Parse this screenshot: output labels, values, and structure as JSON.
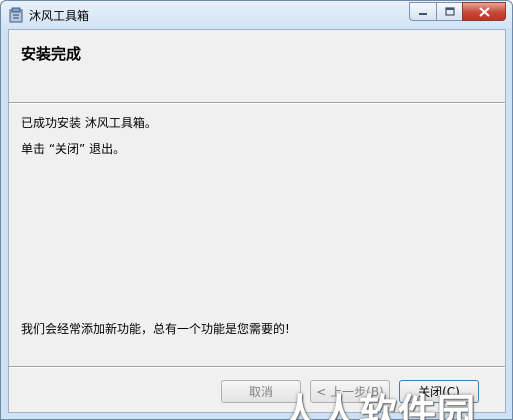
{
  "window": {
    "title": "沐风工具箱",
    "app_icon": "installer-box-icon",
    "controls": {
      "minimize": "minimize-icon",
      "maximize": "maximize-icon",
      "close": "close-icon"
    }
  },
  "header": {
    "title": "安装完成"
  },
  "body": {
    "line1": "已成功安装 沐风工具箱。",
    "line2": "单击 “关闭” 退出。",
    "line3": "我们会经常添加新功能，总有一个功能是您需要的!"
  },
  "buttons": {
    "cancel": "取消",
    "back": "< 上一步(B)",
    "close": "关闭(C)"
  },
  "watermark": "人人软件园",
  "colors": {
    "titlebar": "#d3e4f6",
    "client": "#f0f0f0",
    "close_button": "#c7493a"
  }
}
